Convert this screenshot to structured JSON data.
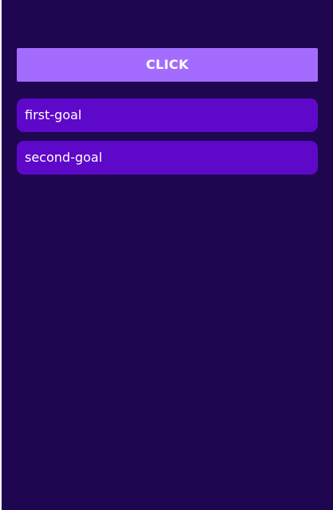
{
  "colors": {
    "background": "#1e0650",
    "button": "#a36cff",
    "goal_item": "#5e08c9",
    "text": "#ffffff"
  },
  "button": {
    "label": "CLICK"
  },
  "goals": [
    {
      "label": "first-goal"
    },
    {
      "label": "second-goal"
    }
  ]
}
